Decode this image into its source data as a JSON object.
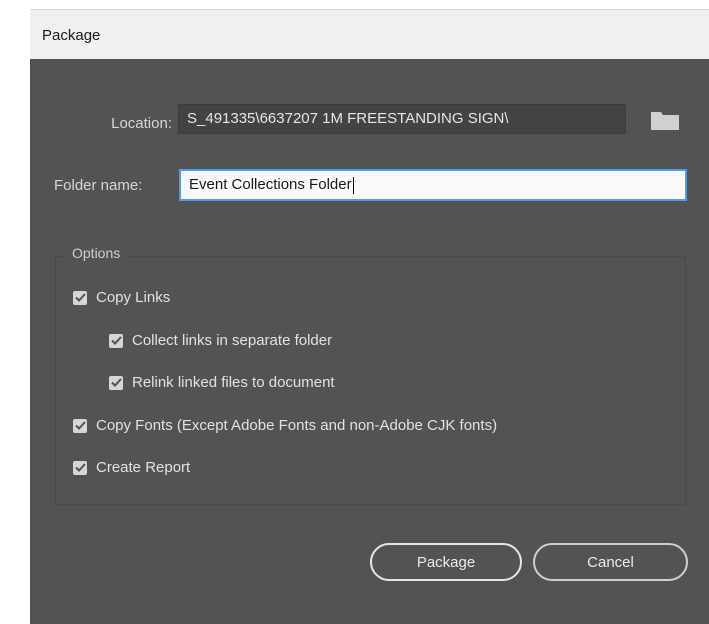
{
  "dialog": {
    "title": "Package"
  },
  "location": {
    "label": "Location:",
    "value": "S_491335\\6637207 1M FREESTANDING SIGN\\"
  },
  "folder_name": {
    "label": "Folder name:",
    "value": "Event Collections Folder"
  },
  "options": {
    "title": "Options",
    "items": [
      {
        "label": "Copy Links",
        "checked": true
      },
      {
        "label": "Collect links in separate folder",
        "checked": true
      },
      {
        "label": "Relink linked files to document",
        "checked": true
      },
      {
        "label": "Copy Fonts (Except Adobe Fonts and non-Adobe CJK fonts)",
        "checked": true
      },
      {
        "label": "Create Report",
        "checked": true
      }
    ]
  },
  "buttons": {
    "package_label": "Package",
    "cancel_label": "Cancel"
  },
  "icons": {
    "folder": "folder-icon",
    "checkbox_check": "checkmark-icon"
  },
  "colors": {
    "panel_bg": "#535353",
    "field_bg": "#434343",
    "focus_border": "#4d9ef0",
    "titlebar_bg": "#f0f0f0"
  }
}
